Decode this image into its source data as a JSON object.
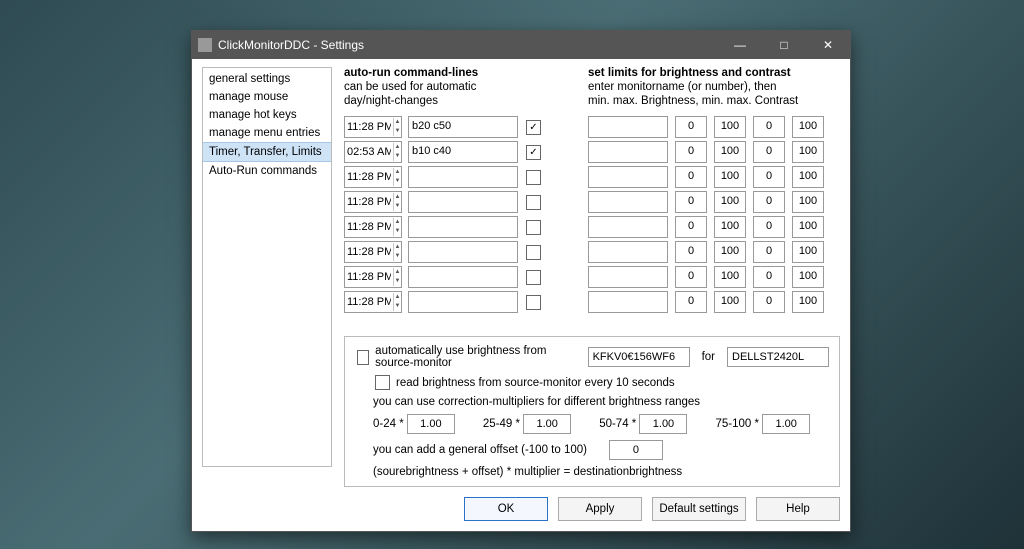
{
  "window": {
    "title": "ClickMonitorDDC - Settings"
  },
  "sidebar": {
    "items": [
      {
        "label": "general settings"
      },
      {
        "label": "manage mouse"
      },
      {
        "label": "manage hot keys"
      },
      {
        "label": "manage menu entries"
      },
      {
        "label": "Timer, Transfer, Limits",
        "selected": true
      },
      {
        "label": "Auto-Run commands"
      }
    ]
  },
  "autorun": {
    "heading": "auto-run command-lines",
    "sub1": "can be used for automatic",
    "sub2": "day/night-changes",
    "rows": [
      {
        "time": "11:28 PM",
        "cmd": "b20 c50",
        "checked": true
      },
      {
        "time": "02:53 AM",
        "cmd": "b10 c40",
        "checked": true
      },
      {
        "time": "11:28 PM",
        "cmd": "",
        "checked": false
      },
      {
        "time": "11:28 PM",
        "cmd": "",
        "checked": false
      },
      {
        "time": "11:28 PM",
        "cmd": "",
        "checked": false
      },
      {
        "time": "11:28 PM",
        "cmd": "",
        "checked": false
      },
      {
        "time": "11:28 PM",
        "cmd": "",
        "checked": false
      },
      {
        "time": "11:28 PM",
        "cmd": "",
        "checked": false
      }
    ]
  },
  "limits": {
    "heading": "set limits for brightness and contrast",
    "sub1": "enter monitorname (or number), then",
    "sub2": "min. max. Brightness, min. max. Contrast",
    "rows": [
      {
        "name": "",
        "bmin": "0",
        "bmax": "100",
        "cmin": "0",
        "cmax": "100"
      },
      {
        "name": "",
        "bmin": "0",
        "bmax": "100",
        "cmin": "0",
        "cmax": "100"
      },
      {
        "name": "",
        "bmin": "0",
        "bmax": "100",
        "cmin": "0",
        "cmax": "100"
      },
      {
        "name": "",
        "bmin": "0",
        "bmax": "100",
        "cmin": "0",
        "cmax": "100"
      },
      {
        "name": "",
        "bmin": "0",
        "bmax": "100",
        "cmin": "0",
        "cmax": "100"
      },
      {
        "name": "",
        "bmin": "0",
        "bmax": "100",
        "cmin": "0",
        "cmax": "100"
      },
      {
        "name": "",
        "bmin": "0",
        "bmax": "100",
        "cmin": "0",
        "cmax": "100"
      },
      {
        "name": "",
        "bmin": "0",
        "bmax": "100",
        "cmin": "0",
        "cmax": "100"
      }
    ]
  },
  "transfer": {
    "auto_label": "automatically use brightness from source-monitor",
    "source_monitor": "KFKV0€156WF6",
    "for_label": "for",
    "dest_monitor": "DELLST2420L",
    "read_label": "read brightness from source-monitor every 10 seconds",
    "mult_note": "you can use correction-multipliers for different brightness ranges",
    "ranges": {
      "r0_label": "0-24  *",
      "r0_val": "1.00",
      "r1_label": "25-49  *",
      "r1_val": "1.00",
      "r2_label": "50-74  *",
      "r2_val": "1.00",
      "r3_label": "75-100  *",
      "r3_val": "1.00"
    },
    "offset_label": "you can add a general offset (-100 to 100)",
    "offset_val": "0",
    "formula": "(sourebrightness + offset) * multiplier = destinationbrightness"
  },
  "buttons": {
    "ok": "OK",
    "apply": "Apply",
    "defaults": "Default settings",
    "help": "Help"
  }
}
